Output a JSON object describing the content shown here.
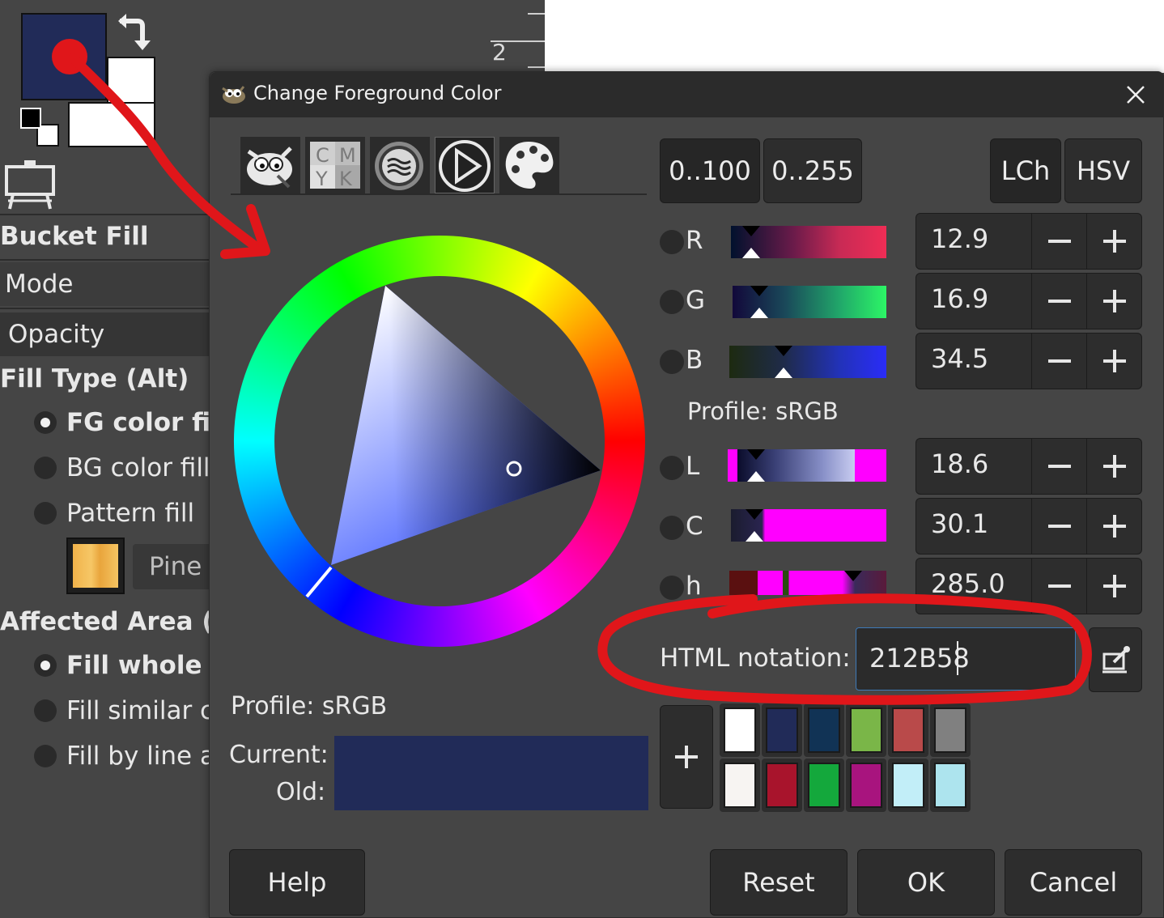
{
  "toolbox": {
    "foreground_color": "#212B58",
    "background_color": "#FFFFFF",
    "tool_title": "Bucket Fill",
    "mode_label": "Mode",
    "opacity_label": "Opacity",
    "fill_type_header": "Fill Type  (Alt)",
    "fill_options": [
      {
        "label": "FG color fill",
        "selected": true
      },
      {
        "label": "BG color fill",
        "selected": false
      },
      {
        "label": "Pattern fill",
        "selected": false
      }
    ],
    "pattern_name": "Pine",
    "affected_area_header": "Affected Area  (S",
    "area_options": [
      {
        "label": "Fill whole s",
        "selected": true
      },
      {
        "label": "Fill similar co",
        "selected": false
      },
      {
        "label": "Fill by line a",
        "selected": false
      }
    ]
  },
  "ruler": {
    "tick_label": "2"
  },
  "dialog": {
    "title": "Change Foreground Color",
    "selector_tabs": [
      "gimp-selector-icon",
      "cmyk-icon",
      "water-icon",
      "triangle-play-icon",
      "palette-icon"
    ],
    "cmyk_letters": [
      "C",
      "M",
      "Y",
      "K"
    ],
    "range_buttons": [
      "0..100",
      "0..255"
    ],
    "model_buttons": [
      "LCh",
      "HSV"
    ],
    "channels_rgb": [
      {
        "name": "R",
        "value": "12.9"
      },
      {
        "name": "G",
        "value": "16.9"
      },
      {
        "name": "B",
        "value": "34.5"
      }
    ],
    "profile_right": "Profile: sRGB",
    "channels_lch": [
      {
        "name": "L",
        "value": "18.6"
      },
      {
        "name": "C",
        "value": "30.1"
      },
      {
        "name": "h",
        "value": "285.0"
      }
    ],
    "html_notation_label": "HTML notation:",
    "html_notation_value": "212B58",
    "profile_left": "Profile: sRGB",
    "current_label": "Current:",
    "old_label": "Old:",
    "current_color": "#212B58",
    "old_color": "#212B58",
    "history_colors": [
      [
        "#FFFFFF",
        "#212B58",
        "#113355",
        "#7AB648",
        "#B94A4A",
        "#808080"
      ],
      [
        "#F7F4F2",
        "#A8142C",
        "#14A83C",
        "#A8147E",
        "#C2EEF8",
        "#ADE4EE"
      ]
    ],
    "buttons": {
      "help": "Help",
      "reset": "Reset",
      "ok": "OK",
      "cancel": "Cancel"
    }
  },
  "annotation_color": "#E0161A"
}
